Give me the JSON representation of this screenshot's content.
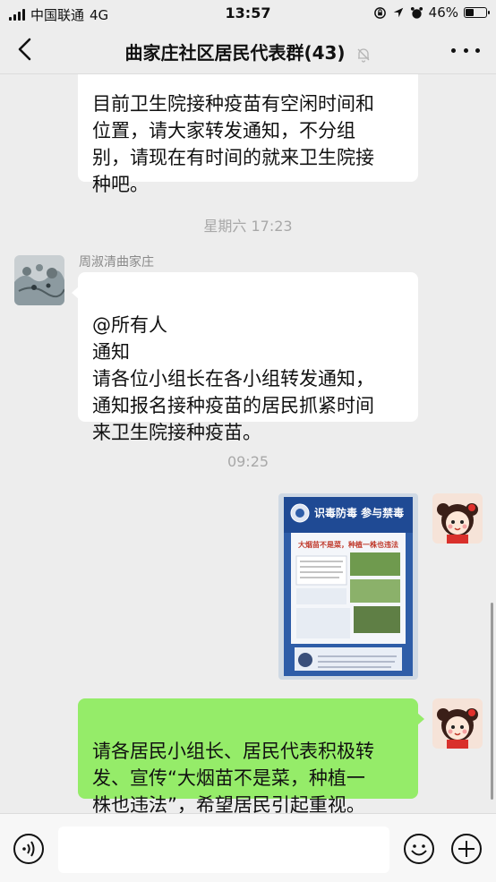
{
  "status_bar": {
    "carrier": "中国联通",
    "network": "4G",
    "time": "13:57",
    "battery": "46%",
    "battery_level": 0.46
  },
  "nav": {
    "title": "曲家庄社区居民代表群(43)"
  },
  "messages": {
    "first_bubble_text": "目前卫生院接种疫苗有空闲时间和\n位置，请大家转发通知，不分组\n别，请现在有时间的就来卫生院接\n种吧。",
    "timestamp_1": "星期六 17:23",
    "sender_name": "周淑清曲家庄",
    "second_bubble_text": "@所有人\n通知\n请各位小组长在各小组转发通知，\n通知报名接种疫苗的居民抓紧时间\n来卫生院接种疫苗。",
    "timestamp_2": "09:25",
    "poster": {
      "headline": "识毒防毒 参与禁毒",
      "subhead": "大烟苗不是菜，种植一株也违法"
    },
    "green_bubble_text": "请各居民小组长、居民代表积极转\n发、宣传“大烟苗不是菜，种植一\n株也违法”，希望居民引起重视。"
  },
  "colors": {
    "background": "#ededed",
    "green_bubble": "#95ec69",
    "white_bubble": "#ffffff",
    "timestamp": "#a8a8a8"
  }
}
